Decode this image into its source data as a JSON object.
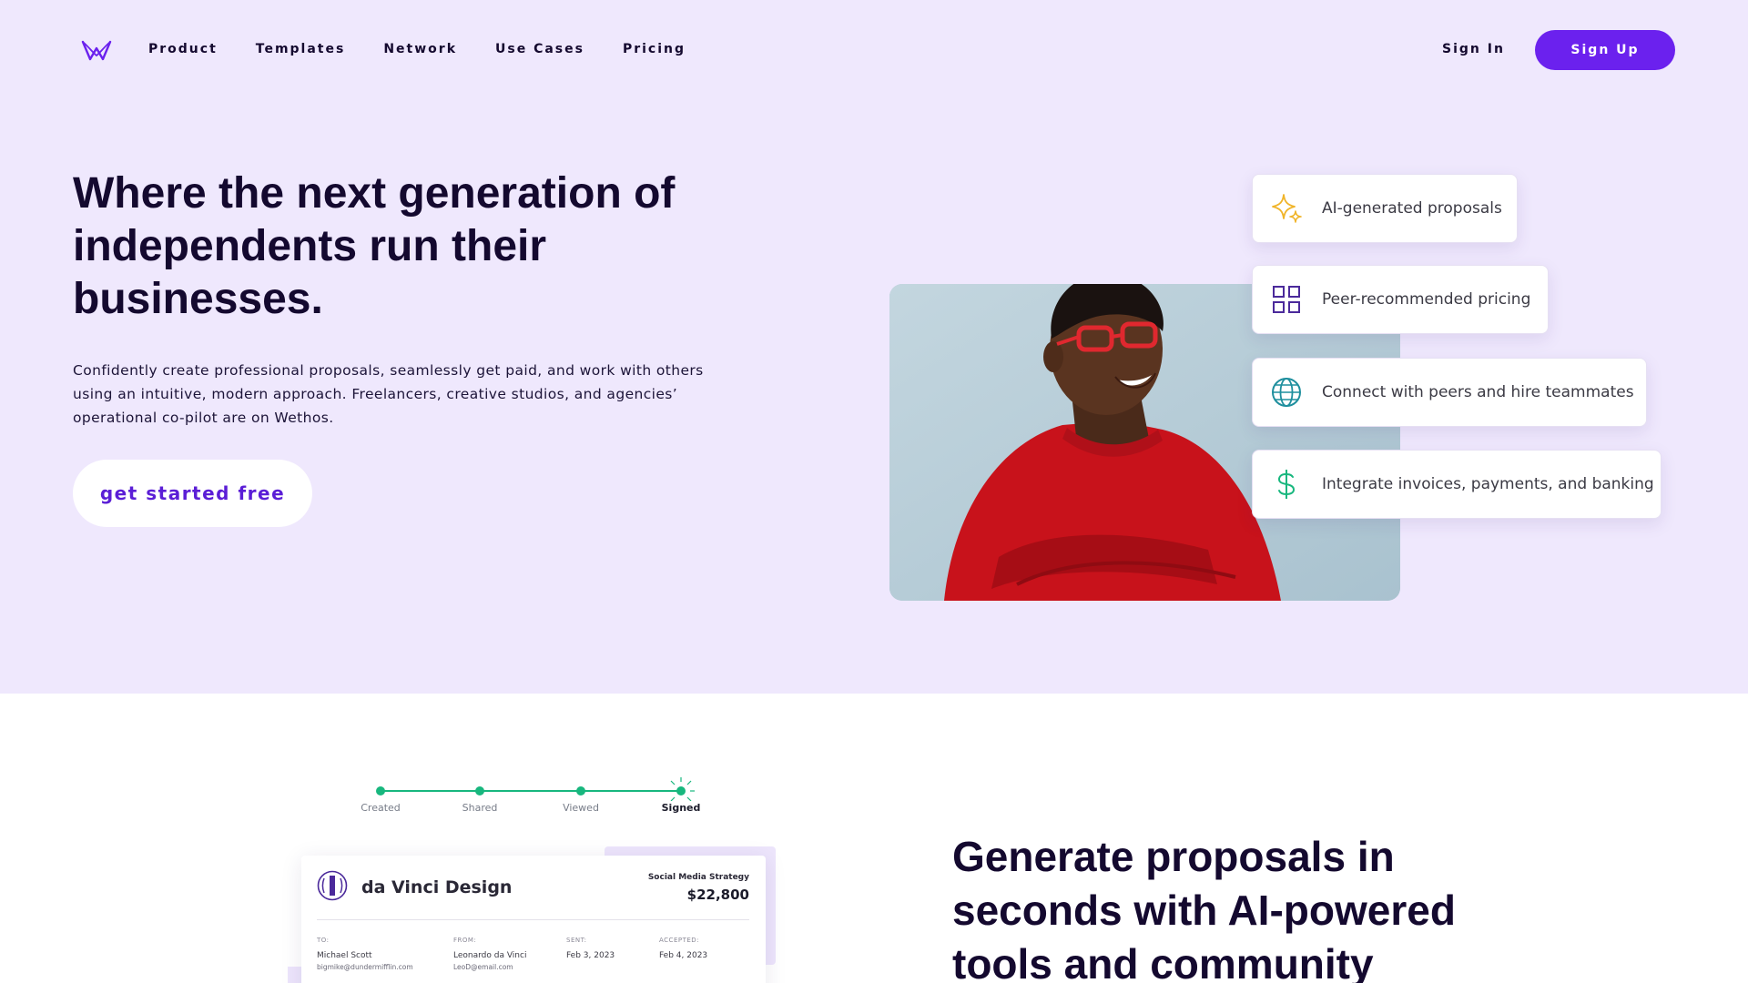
{
  "nav": {
    "links": [
      "Product",
      "Templates",
      "Network",
      "Use Cases",
      "Pricing"
    ],
    "sign_in": "Sign In",
    "sign_up": "Sign Up"
  },
  "hero": {
    "title": "Where the next generation of independents run their businesses.",
    "description": "Confidently create professional proposals, seamlessly get paid, and work with others using an intuitive, modern approach. Freelancers, creative studios, and agencies’ operational co-pilot are on Wethos.",
    "cta": "get started free"
  },
  "features": [
    {
      "label": "AI-generated proposals",
      "icon": "sparkle-icon"
    },
    {
      "label": "Peer-recommended pricing",
      "icon": "grid-icon"
    },
    {
      "label": "Connect with peers and hire teammates",
      "icon": "globe-icon"
    },
    {
      "label": "Integrate invoices, payments, and banking",
      "icon": "dollar-icon"
    }
  ],
  "progress": {
    "steps": [
      "Created",
      "Shared",
      "Viewed",
      "Signed"
    ],
    "active": "Signed"
  },
  "proposal": {
    "company": "da Vinci Design",
    "project": "Social Media Strategy",
    "amount": "$22,800",
    "to_label": "TO:",
    "to_name": "Michael Scott",
    "to_email": "bigmike@dundermifflin.com",
    "from_label": "FROM:",
    "from_name": "Leonardo da Vinci",
    "from_email": "LeoD@email.com",
    "sent_label": "SENT:",
    "sent_date": "Feb 3, 2023",
    "accepted_label": "ACCEPTED:",
    "accepted_date": "Feb 4, 2023"
  },
  "section": {
    "title": "Generate proposals in seconds with AI-powered tools and community"
  },
  "colors": {
    "hero_bg": "#efe8fd",
    "primary": "#6b21ee",
    "heading": "#14092f",
    "progress": "#18b77e"
  }
}
